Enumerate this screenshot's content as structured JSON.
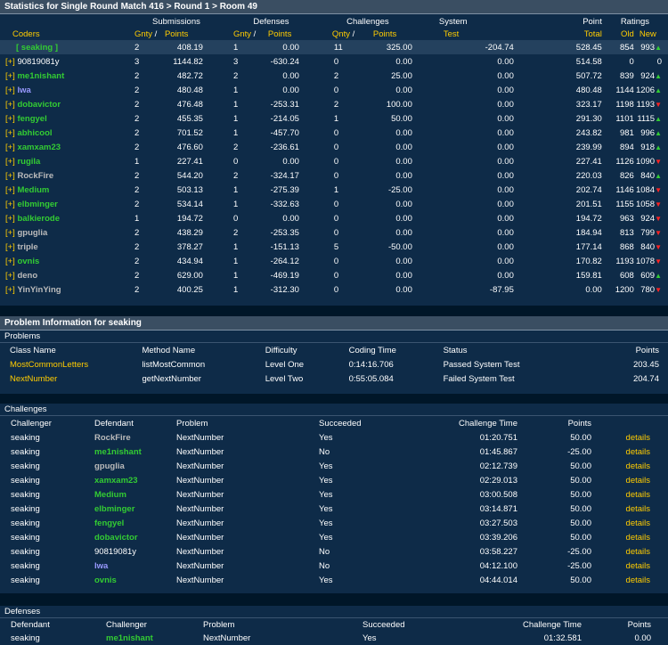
{
  "header": {
    "title": "Statistics for Single Round Match 416 > Round 1 > Room 49"
  },
  "room_table": {
    "group_headers": {
      "submissions": "Submissions",
      "defenses": "Defenses",
      "challenges": "Challenges",
      "system": "System",
      "point": "Point",
      "ratings": "Ratings"
    },
    "columns": {
      "coders": "Coders",
      "gnty": "Gnty",
      "slash": "/",
      "points": "Points",
      "gnty2": "Gnty",
      "points2": "Points",
      "qnty": "Qnty",
      "points3": "Points",
      "test": "Test",
      "total": "Total",
      "old": "Old",
      "new": "New"
    },
    "rows": [
      {
        "prefix": "",
        "name": "[ seaking ]",
        "color": "green",
        "sub_q": "2",
        "sub_p": "408.19",
        "def_q": "1",
        "def_p": "0.00",
        "ch_q": "11",
        "ch_p": "325.00",
        "sys": "-204.74",
        "total": "528.45",
        "old": "854",
        "new": "993",
        "trend": "up"
      },
      {
        "prefix": "[+]",
        "name": "90819081y",
        "color": "white",
        "sub_q": "3",
        "sub_p": "1144.82",
        "def_q": "3",
        "def_p": "-630.24",
        "ch_q": "0",
        "ch_p": "0.00",
        "sys": "0.00",
        "total": "514.58",
        "old": "0",
        "new": "0",
        "trend": ""
      },
      {
        "prefix": "[+]",
        "name": "me1nishant",
        "color": "green",
        "sub_q": "2",
        "sub_p": "482.72",
        "def_q": "2",
        "def_p": "0.00",
        "ch_q": "2",
        "ch_p": "25.00",
        "sys": "0.00",
        "total": "507.72",
        "old": "839",
        "new": "924",
        "trend": "up"
      },
      {
        "prefix": "[+]",
        "name": "lwa",
        "color": "blue",
        "sub_q": "2",
        "sub_p": "480.48",
        "def_q": "1",
        "def_p": "0.00",
        "ch_q": "0",
        "ch_p": "0.00",
        "sys": "0.00",
        "total": "480.48",
        "old": "1144",
        "new": "1206",
        "trend": "up"
      },
      {
        "prefix": "[+]",
        "name": "dobavictor",
        "color": "green",
        "sub_q": "2",
        "sub_p": "476.48",
        "def_q": "1",
        "def_p": "-253.31",
        "ch_q": "2",
        "ch_p": "100.00",
        "sys": "0.00",
        "total": "323.17",
        "old": "1198",
        "new": "1193",
        "trend": "down"
      },
      {
        "prefix": "[+]",
        "name": "fengyel",
        "color": "green",
        "sub_q": "2",
        "sub_p": "455.35",
        "def_q": "1",
        "def_p": "-214.05",
        "ch_q": "1",
        "ch_p": "50.00",
        "sys": "0.00",
        "total": "291.30",
        "old": "1101",
        "new": "1115",
        "trend": "up"
      },
      {
        "prefix": "[+]",
        "name": "abhicool",
        "color": "green",
        "sub_q": "2",
        "sub_p": "701.52",
        "def_q": "1",
        "def_p": "-457.70",
        "ch_q": "0",
        "ch_p": "0.00",
        "sys": "0.00",
        "total": "243.82",
        "old": "981",
        "new": "996",
        "trend": "up"
      },
      {
        "prefix": "[+]",
        "name": "xamxam23",
        "color": "green",
        "sub_q": "2",
        "sub_p": "476.60",
        "def_q": "2",
        "def_p": "-236.61",
        "ch_q": "0",
        "ch_p": "0.00",
        "sys": "0.00",
        "total": "239.99",
        "old": "894",
        "new": "918",
        "trend": "up"
      },
      {
        "prefix": "[+]",
        "name": "rugila",
        "color": "green",
        "sub_q": "1",
        "sub_p": "227.41",
        "def_q": "0",
        "def_p": "0.00",
        "ch_q": "0",
        "ch_p": "0.00",
        "sys": "0.00",
        "total": "227.41",
        "old": "1126",
        "new": "1090",
        "trend": "down"
      },
      {
        "prefix": "[+]",
        "name": "RockFire",
        "color": "gray",
        "sub_q": "2",
        "sub_p": "544.20",
        "def_q": "2",
        "def_p": "-324.17",
        "ch_q": "0",
        "ch_p": "0.00",
        "sys": "0.00",
        "total": "220.03",
        "old": "826",
        "new": "840",
        "trend": "up"
      },
      {
        "prefix": "[+]",
        "name": "Medium",
        "color": "green",
        "sub_q": "2",
        "sub_p": "503.13",
        "def_q": "1",
        "def_p": "-275.39",
        "ch_q": "1",
        "ch_p": "-25.00",
        "sys": "0.00",
        "total": "202.74",
        "old": "1146",
        "new": "1084",
        "trend": "down"
      },
      {
        "prefix": "[+]",
        "name": "elbminger",
        "color": "green",
        "sub_q": "2",
        "sub_p": "534.14",
        "def_q": "1",
        "def_p": "-332.63",
        "ch_q": "0",
        "ch_p": "0.00",
        "sys": "0.00",
        "total": "201.51",
        "old": "1155",
        "new": "1058",
        "trend": "down"
      },
      {
        "prefix": "[+]",
        "name": "balkierode",
        "color": "green",
        "sub_q": "1",
        "sub_p": "194.72",
        "def_q": "0",
        "def_p": "0.00",
        "ch_q": "0",
        "ch_p": "0.00",
        "sys": "0.00",
        "total": "194.72",
        "old": "963",
        "new": "924",
        "trend": "down"
      },
      {
        "prefix": "[+]",
        "name": "gpuglia",
        "color": "gray",
        "sub_q": "2",
        "sub_p": "438.29",
        "def_q": "2",
        "def_p": "-253.35",
        "ch_q": "0",
        "ch_p": "0.00",
        "sys": "0.00",
        "total": "184.94",
        "old": "813",
        "new": "799",
        "trend": "down"
      },
      {
        "prefix": "[+]",
        "name": "triple",
        "color": "gray",
        "sub_q": "2",
        "sub_p": "378.27",
        "def_q": "1",
        "def_p": "-151.13",
        "ch_q": "5",
        "ch_p": "-50.00",
        "sys": "0.00",
        "total": "177.14",
        "old": "868",
        "new": "840",
        "trend": "down"
      },
      {
        "prefix": "[+]",
        "name": "ovnis",
        "color": "green",
        "sub_q": "2",
        "sub_p": "434.94",
        "def_q": "1",
        "def_p": "-264.12",
        "ch_q": "0",
        "ch_p": "0.00",
        "sys": "0.00",
        "total": "170.82",
        "old": "1193",
        "new": "1078",
        "trend": "down"
      },
      {
        "prefix": "[+]",
        "name": "deno",
        "color": "gray",
        "sub_q": "2",
        "sub_p": "629.00",
        "def_q": "1",
        "def_p": "-469.19",
        "ch_q": "0",
        "ch_p": "0.00",
        "sys": "0.00",
        "total": "159.81",
        "old": "608",
        "new": "609",
        "trend": "up"
      },
      {
        "prefix": "[+]",
        "name": "YinYinYing",
        "color": "gray",
        "sub_q": "2",
        "sub_p": "400.25",
        "def_q": "1",
        "def_p": "-312.30",
        "ch_q": "0",
        "ch_p": "0.00",
        "sys": "-87.95",
        "total": "0.00",
        "old": "1200",
        "new": "780",
        "trend": "down"
      }
    ]
  },
  "problem_info": {
    "title": "Problem Information for seaking",
    "problems_label": "Problems",
    "columns": {
      "class": "Class Name",
      "method": "Method Name",
      "difficulty": "Difficulty",
      "time": "Coding Time",
      "status": "Status",
      "points": "Points"
    },
    "rows": [
      {
        "class": "MostCommonLetters",
        "method": "listMostCommon",
        "difficulty": "Level One",
        "time": "0:14:16.706",
        "status": "Passed System Test",
        "points": "203.45"
      },
      {
        "class": "NextNumber",
        "method": "getNextNumber",
        "difficulty": "Level Two",
        "time": "0:55:05.084",
        "status": "Failed System Test",
        "points": "204.74"
      }
    ]
  },
  "challenges": {
    "label": "Challenges",
    "columns": {
      "challenger": "Challenger",
      "defendant": "Defendant",
      "problem": "Problem",
      "succeeded": "Succeeded",
      "time": "Challenge Time",
      "points": "Points"
    },
    "details_label": "details",
    "rows": [
      {
        "challenger": "seaking",
        "defendant": "RockFire",
        "dcolor": "gray",
        "problem": "NextNumber",
        "succeeded": "Yes",
        "time": "01:20.751",
        "points": "50.00"
      },
      {
        "challenger": "seaking",
        "defendant": "me1nishant",
        "dcolor": "green",
        "problem": "NextNumber",
        "succeeded": "No",
        "time": "01:45.867",
        "points": "-25.00"
      },
      {
        "challenger": "seaking",
        "defendant": "gpuglia",
        "dcolor": "gray",
        "problem": "NextNumber",
        "succeeded": "Yes",
        "time": "02:12.739",
        "points": "50.00"
      },
      {
        "challenger": "seaking",
        "defendant": "xamxam23",
        "dcolor": "green",
        "problem": "NextNumber",
        "succeeded": "Yes",
        "time": "02:29.013",
        "points": "50.00"
      },
      {
        "challenger": "seaking",
        "defendant": "Medium",
        "dcolor": "green",
        "problem": "NextNumber",
        "succeeded": "Yes",
        "time": "03:00.508",
        "points": "50.00"
      },
      {
        "challenger": "seaking",
        "defendant": "elbminger",
        "dcolor": "green",
        "problem": "NextNumber",
        "succeeded": "Yes",
        "time": "03:14.871",
        "points": "50.00"
      },
      {
        "challenger": "seaking",
        "defendant": "fengyel",
        "dcolor": "green",
        "problem": "NextNumber",
        "succeeded": "Yes",
        "time": "03:27.503",
        "points": "50.00"
      },
      {
        "challenger": "seaking",
        "defendant": "dobavictor",
        "dcolor": "green",
        "problem": "NextNumber",
        "succeeded": "Yes",
        "time": "03:39.206",
        "points": "50.00"
      },
      {
        "challenger": "seaking",
        "defendant": "90819081y",
        "dcolor": "white",
        "problem": "NextNumber",
        "succeeded": "No",
        "time": "03:58.227",
        "points": "-25.00"
      },
      {
        "challenger": "seaking",
        "defendant": "lwa",
        "dcolor": "blue",
        "problem": "NextNumber",
        "succeeded": "No",
        "time": "04:12.100",
        "points": "-25.00"
      },
      {
        "challenger": "seaking",
        "defendant": "ovnis",
        "dcolor": "green",
        "problem": "NextNumber",
        "succeeded": "Yes",
        "time": "04:44.014",
        "points": "50.00"
      }
    ]
  },
  "defenses": {
    "label": "Defenses",
    "columns": {
      "defendant": "Defendant",
      "challenger": "Challenger",
      "problem": "Problem",
      "succeeded": "Succeeded",
      "time": "Challenge Time",
      "points": "Points"
    },
    "rows": [
      {
        "defendant": "seaking",
        "challenger": "me1nishant",
        "ccolor": "green",
        "problem": "NextNumber",
        "succeeded": "Yes",
        "time": "01:32.581",
        "points": "0.00"
      }
    ]
  },
  "colors": {
    "background": "#001628",
    "panel": "#0e2b48",
    "title_bar": "#3a4e62",
    "green": "#33cc33",
    "yellow": "#ffcc00",
    "blue": "#9999ff",
    "red": "#ff2222"
  }
}
